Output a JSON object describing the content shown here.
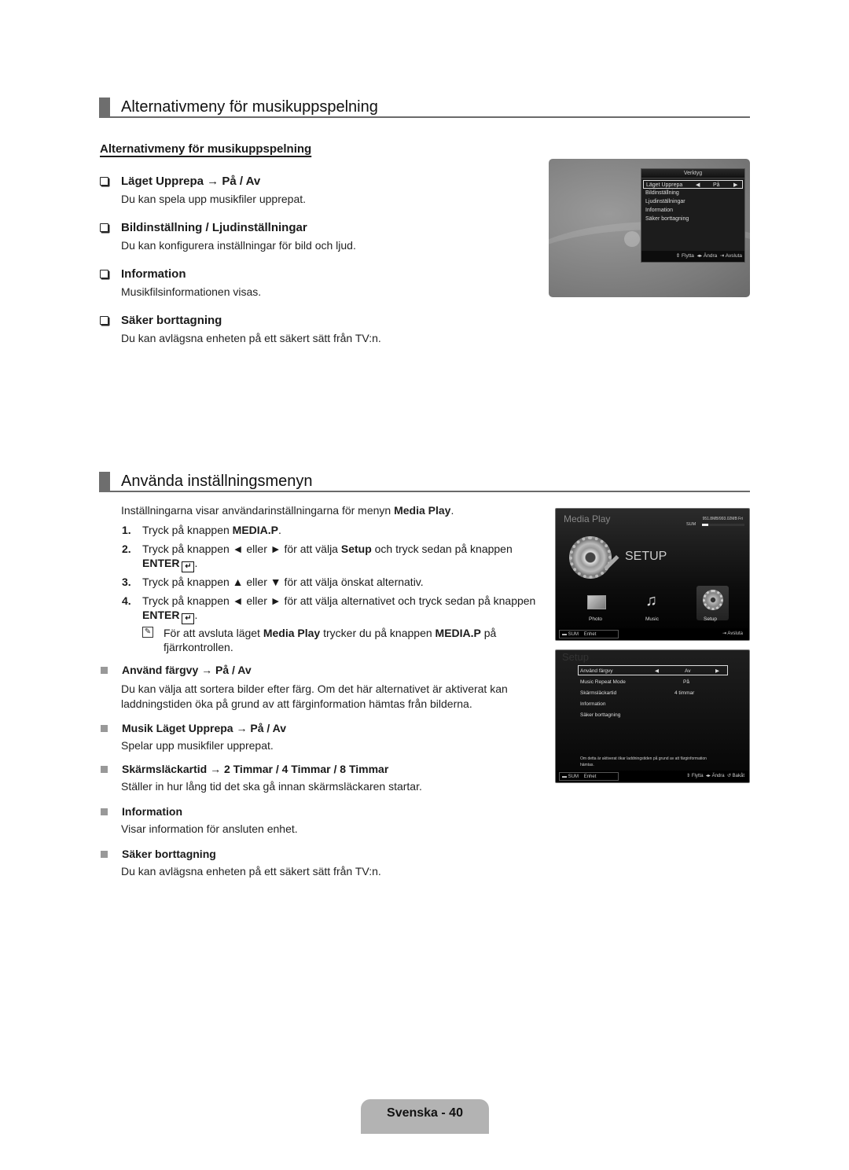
{
  "section1": {
    "title": "Alternativmeny för musikuppspelning",
    "subheading": "Alternativmeny för musikuppspelning",
    "items": [
      {
        "title": "Läget Upprepa → På / Av",
        "desc": "Du kan spela upp musikfiler upprepat."
      },
      {
        "title": "Bildinställning / Ljudinställningar",
        "desc": "Du kan konfigurera inställningar för bild och ljud."
      },
      {
        "title": "Information",
        "desc": "Musikfilsinformationen visas."
      },
      {
        "title": "Säker borttagning",
        "desc": "Du kan avlägsna enheten på ett säkert sätt från TV:n."
      }
    ],
    "screen": {
      "menu_title": "Verktyg",
      "items": [
        "Läget Upprepa",
        "Bildinställning",
        "Ljudinställningar",
        "Information",
        "Säker borttagning"
      ],
      "selected_value": "På",
      "footer": {
        "move": "Flytta",
        "change": "Ändra",
        "exit": "Avsluta"
      }
    }
  },
  "section2": {
    "title": "Använda inställningsmenyn",
    "intro_pre": "Inställningarna visar användarinställningarna för menyn ",
    "intro_bold": "Media Play",
    "intro_post": ".",
    "steps": [
      {
        "num": "1.",
        "parts": [
          "Tryck på knappen ",
          "MEDIA.P",
          "."
        ]
      },
      {
        "num": "2.",
        "parts": [
          "Tryck på knappen ◄ eller ► för att välja ",
          "Setup",
          " och tryck sedan på knappen"
        ],
        "enter": "ENTER"
      },
      {
        "num": "3.",
        "parts": [
          "Tryck på knappen ▲ eller ▼ för att välja önskat alternativ."
        ]
      },
      {
        "num": "4.",
        "parts": [
          "Tryck på knappen ◄ eller ► för att välja alternativet och tryck sedan på knappen"
        ],
        "enter": "ENTER"
      }
    ],
    "note": {
      "pre": "För att avsluta läget ",
      "b1": "Media Play",
      "mid": " trycker du på knappen ",
      "b2": "MEDIA.P",
      "post": " på",
      "line2": "fjärrkontrollen."
    },
    "options": [
      {
        "title": "Använd färgvy → På / Av",
        "desc": [
          "Du kan välja att sortera bilder efter färg. Om det här alternativet är aktiverat kan",
          "laddningstiden öka på grund av att färginformation hämtas från bilderna."
        ]
      },
      {
        "title": "Musik Läget Upprepa → På / Av",
        "desc": [
          "Spelar upp musikfiler upprepat."
        ]
      },
      {
        "title": "Skärmsläckartid → 2 Timmar / 4 Timmar / 8 Timmar",
        "desc": [
          "Ställer in hur lång tid det ska gå innan skärmsläckaren startar."
        ]
      },
      {
        "title": "Information",
        "desc": [
          "Visar information för ansluten enhet."
        ]
      },
      {
        "title": "Säker borttagning",
        "desc": [
          "Du kan avlägsna enheten på ett säkert sätt från TV:n."
        ]
      }
    ],
    "media_screen": {
      "title": "Media Play",
      "storage": "951.8MB/993.02MB Fri",
      "storage_used_fraction": 0.15,
      "device": "SUM",
      "setup_label": "SETUP",
      "icons": [
        "Photo",
        "Music",
        "Setup"
      ],
      "footer": {
        "device": "SUM",
        "unit": "Enhet",
        "exit": "Avsluta"
      }
    },
    "setup_screen": {
      "title": "Setup",
      "rows": [
        {
          "label": "Använd färgvy",
          "value": "Av"
        },
        {
          "label": "Music Repeat Mode",
          "value": "På"
        },
        {
          "label": "Skärmsläckartid",
          "value": "4 timmar"
        },
        {
          "label": "Information",
          "value": ""
        },
        {
          "label": "Säker borttagning",
          "value": ""
        }
      ],
      "hint": [
        "Om detta är aktiverat ökar laddningstiden på grund av att färginformation",
        "hämtas."
      ],
      "footer": {
        "device": "SUM",
        "unit": "Enhet",
        "move": "Flytta",
        "change": "Ändra",
        "back": "Bakåt"
      }
    }
  },
  "page_label": "Svenska - 40"
}
